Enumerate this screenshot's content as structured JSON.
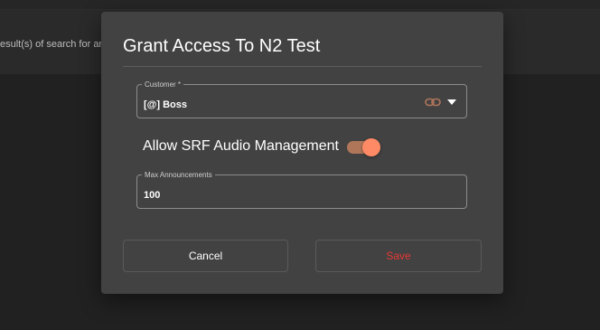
{
  "background": {
    "results_text": "esult(s) of search for an"
  },
  "dialog": {
    "title": "Grant Access To N2 Test",
    "customer_field": {
      "label": "Customer *",
      "value": "[@] Boss",
      "link_icon": "link-icon",
      "dropdown_icon": "chevron-down-icon"
    },
    "toggle": {
      "label": "Allow SRF Audio Management",
      "checked": true
    },
    "max_field": {
      "label": "Max Announcements",
      "value": "100"
    },
    "buttons": {
      "cancel": "Cancel",
      "save": "Save"
    }
  },
  "colors": {
    "accent": "#ff8a65",
    "danger": "#e53935",
    "dialog_bg": "#424242",
    "page_bg": "#212121"
  }
}
